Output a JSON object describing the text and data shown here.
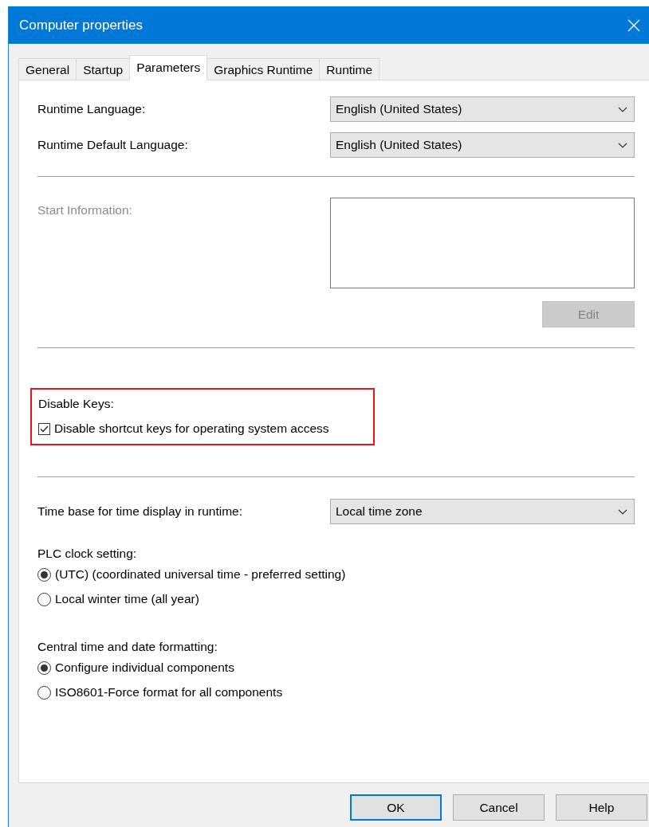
{
  "window": {
    "title": "Computer properties"
  },
  "tabs": [
    {
      "label": "General",
      "selected": false
    },
    {
      "label": "Startup",
      "selected": false
    },
    {
      "label": "Parameters",
      "selected": true
    },
    {
      "label": "Graphics Runtime",
      "selected": false
    },
    {
      "label": "Runtime",
      "selected": false
    }
  ],
  "languages": [
    {
      "label": "Runtime Language:",
      "value": "English (United States)"
    },
    {
      "label": "Runtime Default Language:",
      "value": "English (United States)"
    }
  ],
  "start_information": {
    "label": "Start Information:",
    "disabled": true,
    "edit_button": {
      "label": "Edit",
      "disabled": true
    }
  },
  "disable_keys": {
    "heading": "Disable Keys:",
    "highlighted": true,
    "checkbox": {
      "label": "Disable shortcut keys for operating system access",
      "checked": true
    }
  },
  "time_base": {
    "label": "Time base for time display in runtime:",
    "value": "Local time zone"
  },
  "plc_clock": {
    "label": "PLC clock setting:",
    "options": [
      {
        "label": "(UTC) (coordinated universal time - preferred setting)",
        "selected": true
      },
      {
        "label": "Local winter time (all year)",
        "selected": false
      }
    ]
  },
  "date_formatting": {
    "label": "Central time and date formatting:",
    "options": [
      {
        "label": "Configure individual components",
        "selected": true
      },
      {
        "label": "ISO8601-Force format for all components",
        "selected": false
      }
    ]
  },
  "buttons": [
    {
      "label": "OK",
      "default": true
    },
    {
      "label": "Cancel",
      "default": false
    },
    {
      "label": "Help",
      "default": false
    }
  ]
}
